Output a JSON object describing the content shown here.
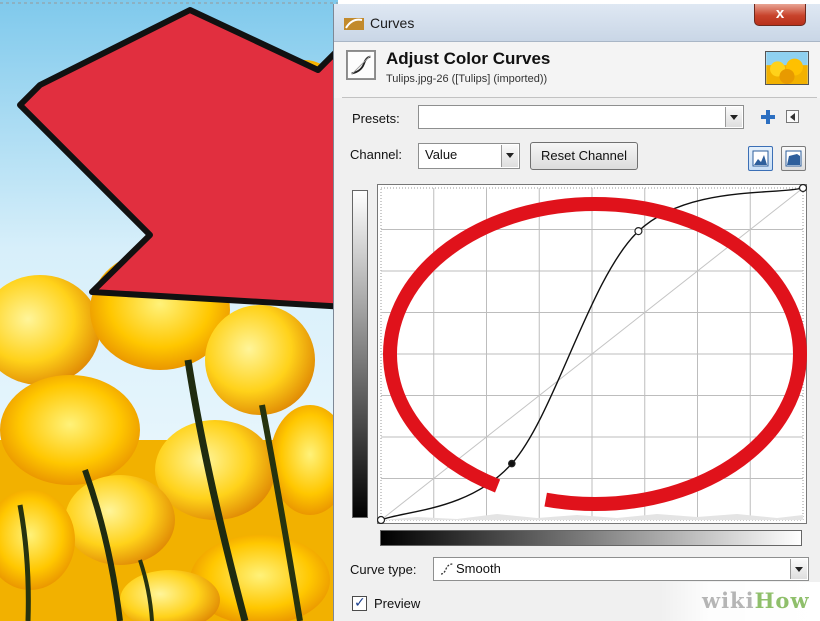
{
  "window": {
    "title": "Curves",
    "close_label": "x"
  },
  "header": {
    "title": "Adjust Color Curves",
    "subtitle": "Tulips.jpg-26 ([Tulips] (imported))"
  },
  "presets": {
    "label": "Presets:",
    "value": ""
  },
  "channel": {
    "label": "Channel:",
    "value": "Value",
    "reset_label": "Reset Channel"
  },
  "curve": {
    "points": [
      [
        0,
        0
      ],
      [
        0.31,
        0.17
      ],
      [
        0.61,
        0.87
      ],
      [
        1,
        1
      ]
    ],
    "highlight_color": "#e0121b"
  },
  "curve_type": {
    "label": "Curve type:",
    "value": "Smooth"
  },
  "preview": {
    "label": "Preview",
    "checked": true
  },
  "watermark": {
    "wiki": "wiki",
    "how": "How"
  },
  "colors": {
    "arrow": "#e12f3f",
    "titlebar": "#c9d6e6",
    "close": "#c8432c"
  },
  "icons": [
    "curves-app-icon",
    "curves-tool-icon",
    "tulips-thumbnail",
    "add-preset-icon",
    "preset-menu-icon",
    "linear-histogram-icon",
    "log-histogram-icon",
    "smooth-curve-icon",
    "checkmark-icon",
    "pointer-arrow"
  ]
}
